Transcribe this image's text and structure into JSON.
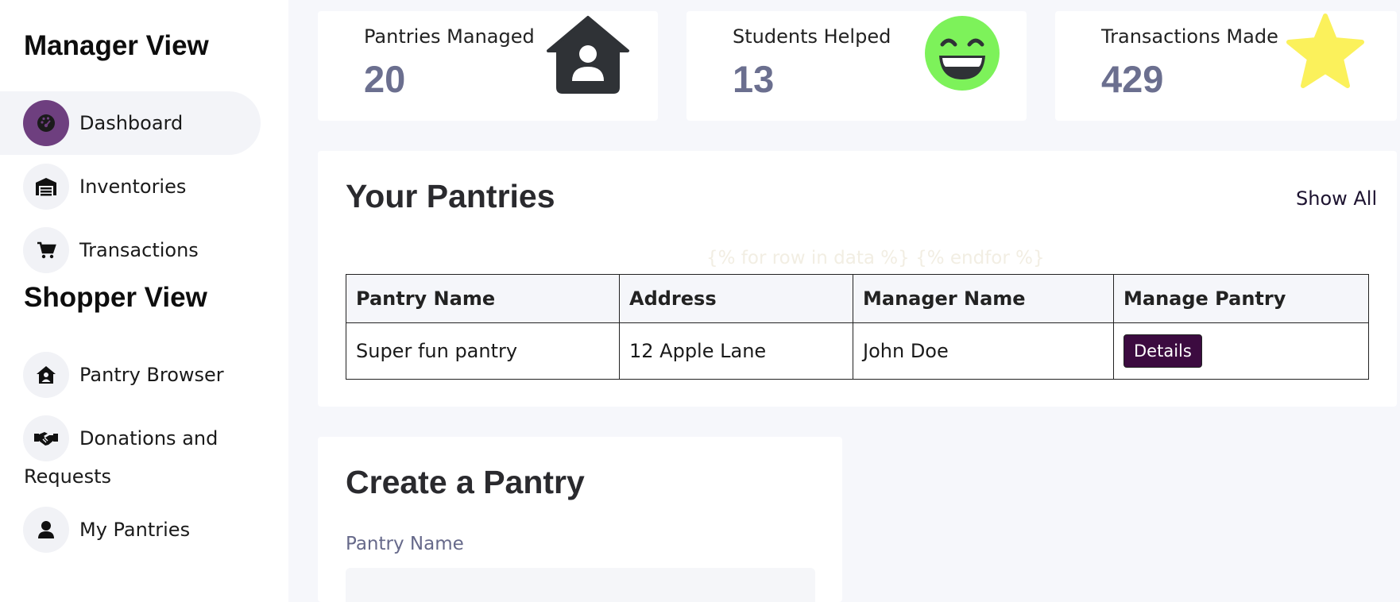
{
  "sidebar": {
    "manager_title": "Manager View",
    "manager_items": [
      {
        "label": "Dashboard",
        "icon": "dashboard-icon"
      },
      {
        "label": "Inventories",
        "icon": "warehouse-icon"
      },
      {
        "label": "Transactions",
        "icon": "cart-icon"
      }
    ],
    "shopper_title": "Shopper View",
    "shopper_items": [
      {
        "label": "Pantry Browser",
        "icon": "house-user-icon"
      },
      {
        "label_line1": "Donations and",
        "label_line2": "Requests",
        "icon": "handshake-icon"
      },
      {
        "label": "My Pantries",
        "icon": "user-icon"
      }
    ]
  },
  "stats": [
    {
      "label": "Pantries Managed",
      "value": "20",
      "icon": "house-user-icon"
    },
    {
      "label": "Students Helped",
      "value": "13",
      "icon": "grin-icon"
    },
    {
      "label": "Transactions Made",
      "value": "429",
      "icon": "star-icon"
    }
  ],
  "pantries": {
    "title": "Your Pantries",
    "show_all": "Show All",
    "template_text": "{% for row in data %} {% endfor %}",
    "columns": [
      "Pantry Name",
      "Address",
      "Manager Name",
      "Manage Pantry"
    ],
    "rows": [
      {
        "name": "Super fun pantry",
        "address": "12 Apple Lane",
        "manager": "John Doe",
        "action": "Details"
      }
    ]
  },
  "create": {
    "title": "Create a Pantry",
    "field_label": "Pantry Name",
    "field_value": ""
  },
  "colors": {
    "accent": "#6e3f7f",
    "button": "#3c0b40",
    "stat_value": "#6b6f8f",
    "grin": "#7df25a",
    "star": "#fbf15b",
    "house": "#2f3236"
  }
}
